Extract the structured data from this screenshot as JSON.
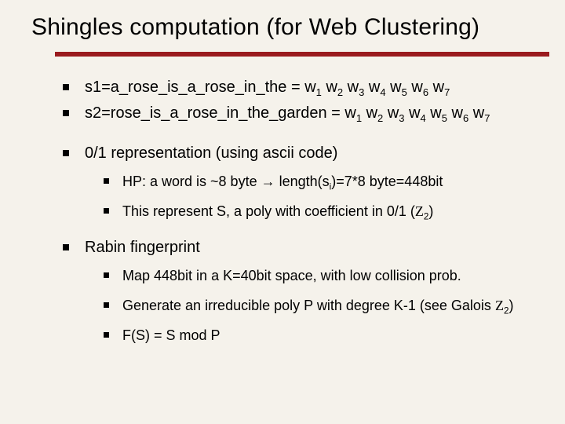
{
  "title": "Shingles computation (for Web Clustering)",
  "bullets": {
    "b1_pre": "s1=a_rose_is_a_rose_in_the = w",
    "b1_post": "",
    "b2_pre": "s2=rose_is_a_rose_in_the_garden = w",
    "b2_post": "",
    "w_sub": [
      "1",
      "2",
      "3",
      "4",
      "5",
      "6",
      "7"
    ],
    "b3": "0/1 representation (using ascii code)",
    "b3a_pre": "HP: a word is ~8 byte →  length(s",
    "b3a_sub": "i",
    "b3a_post": ")=7*8 byte=448bit",
    "b3b_pre": "This represent S, a  poly with coefficient in 0/1 (",
    "b3b_z": "Z",
    "b3b_zsub": "2",
    "b3b_post": ")",
    "b4": "Rabin fingerprint",
    "b4a": "Map 448bit in a K=40bit space, with low collision prob.",
    "b4b_pre": "Generate an irreducible poly P with degree K-1  (see Galois ",
    "b4b_z": "Z",
    "b4b_zsub": "2",
    "b4b_post": ")",
    "b4c": "F(S) = S mod P"
  }
}
